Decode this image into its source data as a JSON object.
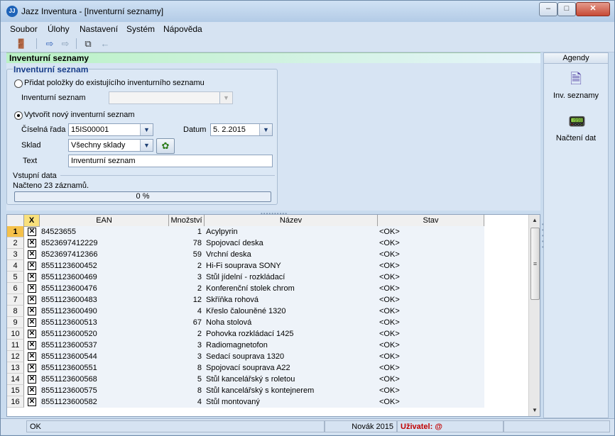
{
  "window": {
    "title": "Jazz Inventura - [Inventurní seznamy]",
    "app_icon_text": "JJ"
  },
  "menu": [
    "Soubor",
    "Úlohy",
    "Nastavení",
    "Systém",
    "Nápověda"
  ],
  "panel": {
    "header": "Inventurní seznamy",
    "group_title": "Inventurní seznam"
  },
  "form": {
    "add_existing_label": "Přidat položky do existujícího inventurního seznamu",
    "existing_list_label": "Inventurní seznam",
    "existing_list_value": "",
    "create_new_label": "Vytvořit nový inventurní seznam",
    "series_label": "Číselná řada",
    "series_value": "15IS00001",
    "date_label": "Datum",
    "date_value": "5. 2.2015",
    "warehouse_label": "Sklad",
    "warehouse_value": "Všechny sklady",
    "text_label": "Text",
    "text_value": "Inventurní seznam",
    "selected_option": "create_new"
  },
  "input_data": {
    "title": "Vstupní data",
    "loaded_text": "Načteno 23 záznamů.",
    "progress_text": "0 %",
    "progress_fraction": 0
  },
  "grid": {
    "columns": {
      "check": "X",
      "ean": "EAN",
      "qty": "Množství",
      "name": "Název",
      "stav": "Stav"
    },
    "rows": [
      {
        "num": "1",
        "ean": "84523655",
        "qty": "1",
        "name": "Acylpyrin",
        "stav": "<OK>"
      },
      {
        "num": "2",
        "ean": "8523697412229",
        "qty": "78",
        "name": "Spojovací deska",
        "stav": "<OK>"
      },
      {
        "num": "3",
        "ean": "8523697412366",
        "qty": "59",
        "name": "Vrchní deska",
        "stav": "<OK>"
      },
      {
        "num": "4",
        "ean": "8551123600452",
        "qty": "2",
        "name": "Hi-Fi souprava SONY",
        "stav": "<OK>"
      },
      {
        "num": "5",
        "ean": "8551123600469",
        "qty": "3",
        "name": "Stůl jídelní - rozkládací",
        "stav": "<OK>"
      },
      {
        "num": "6",
        "ean": "8551123600476",
        "qty": "2",
        "name": "Konferenční stolek chrom",
        "stav": "<OK>"
      },
      {
        "num": "7",
        "ean": "8551123600483",
        "qty": "12",
        "name": "Skříňka rohová",
        "stav": "<OK>"
      },
      {
        "num": "8",
        "ean": "8551123600490",
        "qty": "4",
        "name": "Křeslo čalouněné 1320",
        "stav": "<OK>"
      },
      {
        "num": "9",
        "ean": "8551123600513",
        "qty": "67",
        "name": "Noha stolová",
        "stav": "<OK>"
      },
      {
        "num": "10",
        "ean": "8551123600520",
        "qty": "2",
        "name": "Pohovka rozkládací 1425",
        "stav": "<OK>"
      },
      {
        "num": "11",
        "ean": "8551123600537",
        "qty": "3",
        "name": "Radiomagnetofon",
        "stav": "<OK>"
      },
      {
        "num": "12",
        "ean": "8551123600544",
        "qty": "3",
        "name": "Sedací souprava 1320",
        "stav": "<OK>"
      },
      {
        "num": "13",
        "ean": "8551123600551",
        "qty": "8",
        "name": "Spojovací souprava A22",
        "stav": "<OK>"
      },
      {
        "num": "14",
        "ean": "8551123600568",
        "qty": "5",
        "name": "Stůl kancelářský s roletou",
        "stav": "<OK>"
      },
      {
        "num": "15",
        "ean": "8551123600575",
        "qty": "8",
        "name": "Stůl kancelářský s kontejnerem",
        "stav": "<OK>"
      },
      {
        "num": "16",
        "ean": "8551123600582",
        "qty": "4",
        "name": "Stůl montovaný",
        "stav": "<OK>"
      }
    ]
  },
  "side_panel": {
    "title": "Agendy",
    "items": [
      {
        "label": "Inv. seznamy",
        "icon": "document-list-icon"
      },
      {
        "label": "Načtení dat",
        "icon": "scanner-terminal-icon"
      }
    ]
  },
  "status": {
    "state": "OK",
    "user_period": "Novák 2015",
    "user_label": "Uživatel: @"
  },
  "colors": {
    "selected_row_number": "#f5c14a",
    "check_header": "#f9e07c",
    "user_label": "#c00000",
    "panel_header_gradient_start": "#b9f1c4"
  }
}
